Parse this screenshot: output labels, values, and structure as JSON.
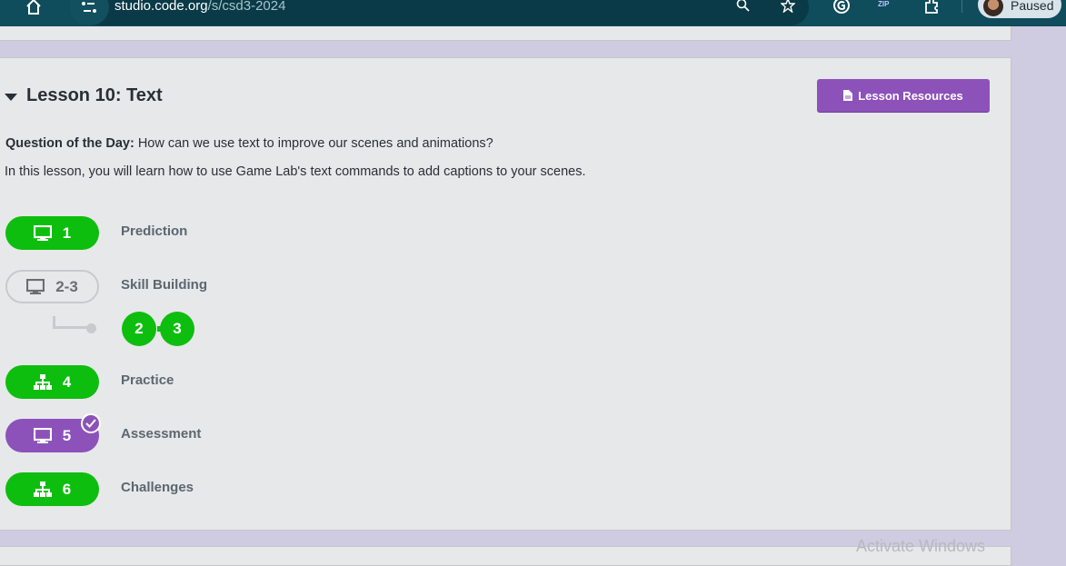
{
  "browser": {
    "url_domain": "studio.code.org",
    "url_path": "/s/csd3-2024",
    "profile_label": "Paused",
    "extension_zip_label": "ZIP"
  },
  "lesson": {
    "title": "Lesson 10: Text",
    "resources_button": "Lesson Resources",
    "question_label": "Question of the Day:",
    "question_text": " How can we use text to improve our scenes and animations?",
    "description": "In this lesson, you will learn how to use Game Lab's text commands to add captions to your scenes.",
    "levels": [
      {
        "number": "1",
        "label": "Prediction",
        "icon": "monitor-icon",
        "status": "complete"
      },
      {
        "number": "2-3",
        "label": "Skill Building",
        "icon": "monitor-icon",
        "status": "not-started"
      },
      {
        "number": "4",
        "label": "Practice",
        "icon": "sitemap-icon",
        "status": "complete"
      },
      {
        "number": "5",
        "label": "Assessment",
        "icon": "monitor-icon",
        "status": "submitted"
      },
      {
        "number": "6",
        "label": "Challenges",
        "icon": "sitemap-icon",
        "status": "complete"
      }
    ],
    "sublevels": [
      "2",
      "3"
    ]
  },
  "os_watermark": "Activate Windows",
  "colors": {
    "complete": "#0ebe0e",
    "submitted": "#8c52ba",
    "browser_bar": "#0f4c5c"
  }
}
